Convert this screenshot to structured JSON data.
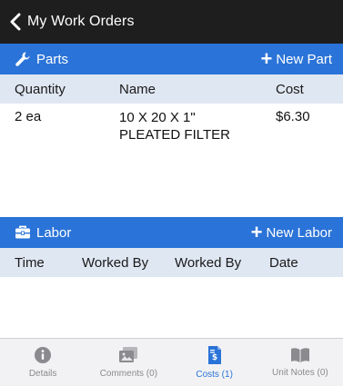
{
  "header": {
    "back_label": "My Work Orders"
  },
  "parts": {
    "title": "Parts",
    "new_label": "New Part",
    "columns": [
      "Quantity",
      "Name",
      "Cost"
    ],
    "rows": [
      {
        "quantity": "2 ea",
        "name_line1": "10 X 20 X 1\"",
        "name_line2": "PLEATED FILTER",
        "cost": "$6.30"
      }
    ]
  },
  "labor": {
    "title": "Labor",
    "new_label": "New Labor",
    "columns": [
      "Time",
      "Worked By",
      "Worked By",
      "Date"
    ]
  },
  "tabs": [
    {
      "label": "Details",
      "icon": "info-icon",
      "active": false
    },
    {
      "label": "Comments (0)",
      "icon": "photo-icon",
      "active": false
    },
    {
      "label": "Costs (1)",
      "icon": "invoice-icon",
      "active": true
    },
    {
      "label": "Unit Notes (0)",
      "icon": "book-icon",
      "active": false
    }
  ],
  "colors": {
    "accent": "#2a73d8",
    "topbar": "#1e1e1e",
    "header_row": "#dfe7f2",
    "tabbar": "#f2f2f4"
  }
}
